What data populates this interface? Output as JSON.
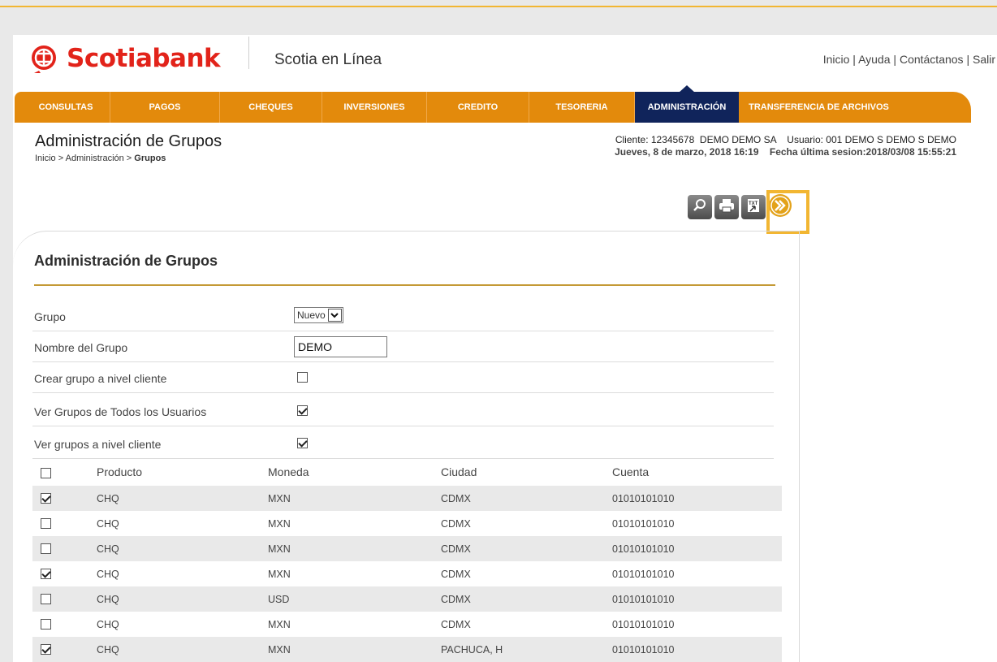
{
  "header": {
    "logo_text": "Scotiabank",
    "product_name": "Scotia en Línea",
    "links": [
      "Inicio",
      "Ayuda",
      "Contáctanos",
      "Salir"
    ],
    "link_separator": " | ",
    "brand_red": "#e2231a"
  },
  "nav": {
    "items": [
      {
        "label": "CONSULTAS",
        "active": false
      },
      {
        "label": "PAGOS",
        "active": false
      },
      {
        "label": "CHEQUES",
        "active": false
      },
      {
        "label": "INVERSIONES",
        "active": false
      },
      {
        "label": "CREDITO",
        "active": false
      },
      {
        "label": "TESORERIA",
        "active": false
      },
      {
        "label": "ADMINISTRACIÓN",
        "active": true
      },
      {
        "label": "TRANSFERENCIA DE ARCHIVOS",
        "active": false
      }
    ],
    "bar_color": "#e38a0c",
    "active_color": "#10245b"
  },
  "page": {
    "title": "Administración de Grupos",
    "breadcrumb": {
      "part1": "Inicio > Administración > ",
      "current": "Grupos"
    },
    "client_line": "Cliente: 12345678  DEMO DEMO SA    Usuario: 001 DEMO S DEMO S DEMO",
    "date_line": "Jueves, 8 de marzo, 2018 16:19    Fecha última sesion:2018/03/08 15:55:21"
  },
  "toolbar": {
    "icons": [
      "search-icon",
      "print-icon",
      "txt-export-icon",
      "next-icon"
    ],
    "highlight_color": "#f2b632"
  },
  "form": {
    "title": "Administración de Grupos",
    "grupo_label": "Grupo",
    "grupo_value": "Nuevo",
    "nombre_label": "Nombre del Grupo",
    "nombre_value": "DEMO",
    "crear_label": "Crear grupo a nivel cliente",
    "crear_checked": false,
    "ver_todos_label": "Ver Grupos de Todos los Usuarios",
    "ver_todos_checked": true,
    "ver_cliente_label": "Ver grupos a nivel cliente",
    "ver_cliente_checked": true
  },
  "table": {
    "headers": {
      "producto": "Producto",
      "moneda": "Moneda",
      "ciudad": "Ciudad",
      "cuenta": "Cuenta"
    },
    "header_checked": false,
    "rows": [
      {
        "checked": true,
        "producto": "CHQ",
        "moneda": "MXN",
        "ciudad": "CDMX",
        "cuenta": "01010101010"
      },
      {
        "checked": false,
        "producto": "CHQ",
        "moneda": "MXN",
        "ciudad": "CDMX",
        "cuenta": "01010101010"
      },
      {
        "checked": false,
        "producto": "CHQ",
        "moneda": "MXN",
        "ciudad": "CDMX",
        "cuenta": "01010101010"
      },
      {
        "checked": true,
        "producto": "CHQ",
        "moneda": "MXN",
        "ciudad": "CDMX",
        "cuenta": "01010101010"
      },
      {
        "checked": false,
        "producto": "CHQ",
        "moneda": "USD",
        "ciudad": "CDMX",
        "cuenta": "01010101010"
      },
      {
        "checked": false,
        "producto": "CHQ",
        "moneda": "MXN",
        "ciudad": "CDMX",
        "cuenta": "01010101010"
      },
      {
        "checked": true,
        "producto": "CHQ",
        "moneda": "MXN",
        "ciudad": "PACHUCA, H",
        "cuenta": "01010101010"
      }
    ]
  }
}
